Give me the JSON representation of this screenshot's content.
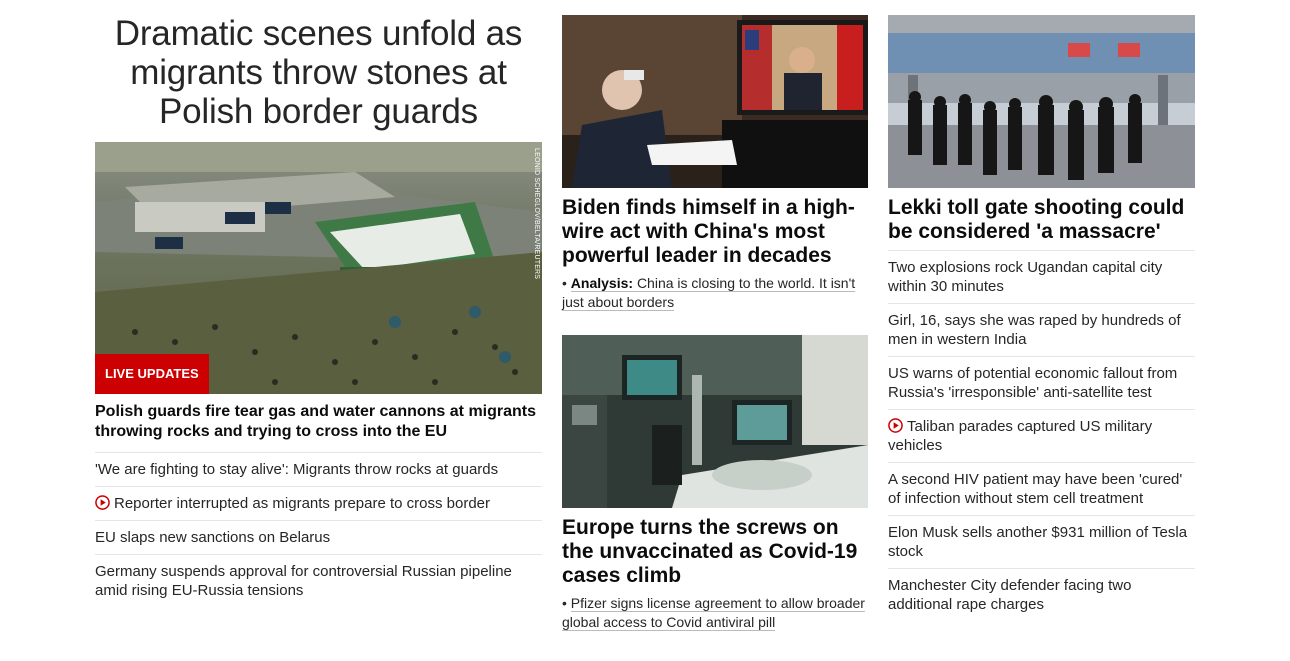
{
  "hero": {
    "headline": "Dramatic scenes unfold as migrants throw stones at Polish border guards",
    "badge": "LIVE UPDATES",
    "credit": "LEONID SCHEGLOV/BELTA/REUTERS",
    "subheadline": "Polish guards fire tear gas and water cannons at migrants throwing rocks and trying to cross into the EU",
    "related": [
      {
        "text": "'We are fighting to stay alive': Migrants throw rocks at guards",
        "video": false
      },
      {
        "text": "Reporter interrupted as migrants prepare to cross border",
        "video": true
      },
      {
        "text": "EU slaps new sanctions on Belarus",
        "video": false
      },
      {
        "text": "Germany suspends approval for controversial Russian pipeline amid rising EU-Russia tensions",
        "video": false
      }
    ]
  },
  "biden": {
    "headline": "Biden finds himself in a high-wire act with China's most powerful leader in decades",
    "sub_prefix": "Analysis:",
    "sub_text": "China is closing to the world. It isn't just about borders"
  },
  "europe": {
    "headline": "Europe turns the screws on the unvaccinated as Covid-19 cases climb",
    "sub_text": "Pfizer signs license agreement to allow broader global access to Covid antiviral pill"
  },
  "lekki": {
    "headline": "Lekki toll gate shooting could be considered 'a massacre'",
    "list": [
      {
        "text": "Two explosions rock Ugandan capital city within 30 minutes",
        "video": false
      },
      {
        "text": "Girl, 16, says she was raped by hundreds of men in western India",
        "video": false
      },
      {
        "text": "US warns of potential economic fallout from Russia's 'irresponsible' anti-satellite test",
        "video": false
      },
      {
        "text": "Taliban parades captured US military vehicles",
        "video": true
      },
      {
        "text": "A second HIV patient may have been 'cured' of infection without stem cell treatment",
        "video": false
      },
      {
        "text": "Elon Musk sells another $931 million of Tesla stock",
        "video": false
      },
      {
        "text": "Manchester City defender facing two additional rape charges",
        "video": false
      }
    ]
  },
  "colors": {
    "accent": "#cc0000",
    "text": "#262626",
    "divider": "#e6e6e6"
  }
}
